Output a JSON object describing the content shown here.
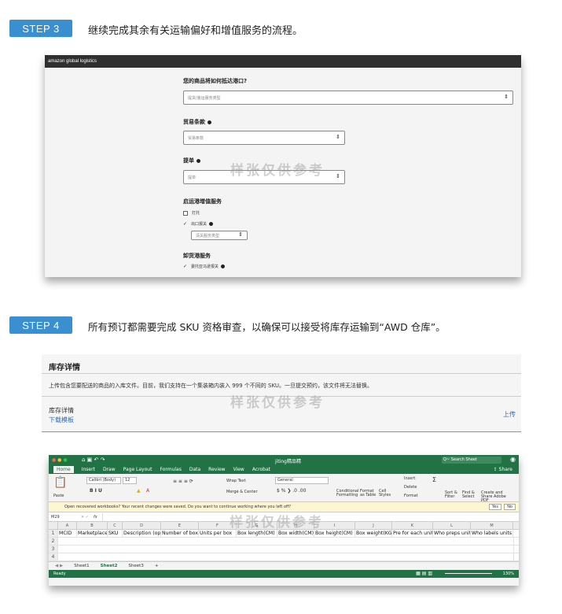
{
  "step3": {
    "badge": "STEP 3",
    "text": "继续完成其余有关运输偏好和增值服务的流程。",
    "app_brand": "amazon global logistics",
    "q_port": "您的商品将如何抵达港口?",
    "port_placeholder": "提货/装运服务类型",
    "incoterm_label": "贸易条款",
    "incoterm_placeholder": "贸易条款",
    "bol_label": "提单",
    "bol_placeholder": "提单",
    "origin_services_label": "启运港增值服务",
    "origin_opt1": "打托",
    "origin_opt2": "出口报关",
    "export_type_placeholder": "清关服务类型",
    "dest_services_label": "卸货港服务",
    "dest_opt1": "委托亚马逊报关"
  },
  "watermark": "样张仅供参考",
  "step4": {
    "badge": "STEP 4",
    "text": "所有预订都需要完成 SKU 资格审查，以确保可以接受将库存运输到“AWD 仓库”。",
    "inv_title": "库存详情",
    "inv_desc": "上传包含您要配送的商品的入库文件。目前，我们支持在一个集装箱内装入 999 个不同的 SKU。一旦提交预约，该文件将无法替换。",
    "inv_label": "库存详情",
    "download_link": "下载模板",
    "upload_link": "上传"
  },
  "excel": {
    "file_title": "jiting精品精",
    "search_placeholder": "Q~ Search Sheet",
    "tabs": [
      "Home",
      "Insert",
      "Draw",
      "Page Layout",
      "Formulas",
      "Data",
      "Review",
      "View",
      "Acrobat"
    ],
    "share": "Share",
    "font_name": "Calibri (Body)",
    "font_size": "12",
    "number_format": "General",
    "wrap_text": "Wrap Text",
    "merge_center": "Merge & Center",
    "paste": "Paste",
    "cond_format": "Conditional Formatting",
    "format_table": "Format as Table",
    "cell_styles": "Cell Styles",
    "insert": "Insert",
    "delete": "Delete",
    "format": "Format",
    "sort_filter": "Sort & Filter",
    "find_select": "Find & Select",
    "create_pdf": "Create and Share Adobe PDF",
    "notice": "Open recovered workbooks?  Your recent changes were saved. Do you want to continue working where you left off?",
    "yes": "Yes",
    "no": "No",
    "cell_ref": "M29",
    "fx": "fx",
    "columns": [
      "A",
      "B",
      "C",
      "D",
      "E",
      "F",
      "G",
      "H",
      "I",
      "J",
      "K",
      "L",
      "M"
    ],
    "headers": [
      "MCID",
      "Marketplace",
      "SKU",
      "Description (optio",
      "Number of box",
      "Units per box",
      "Box length(CM)",
      "Box width(CM)",
      "Box height(CM)",
      "Box weight(KG)",
      "Pre for each unit",
      "Who preps units",
      "Who labels units"
    ],
    "row_numbers": [
      "1",
      "2",
      "3",
      "4"
    ],
    "sheets": [
      "Sheet1",
      "Sheet2",
      "Sheet3"
    ],
    "add_sheet": "+",
    "status": "Ready",
    "zoom": "130%"
  }
}
